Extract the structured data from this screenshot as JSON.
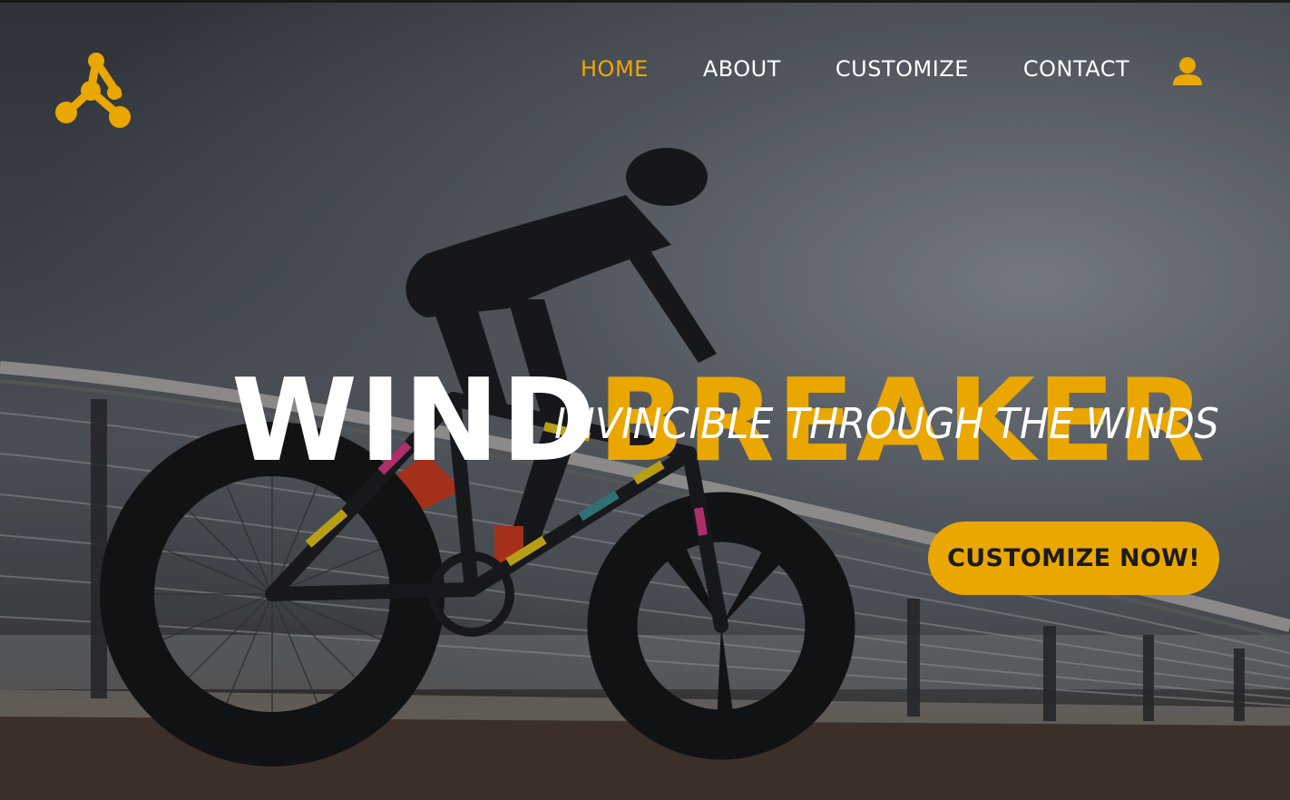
{
  "brand": {
    "logo_icon": "molecule-logo-icon",
    "accent_color": "#eaa700"
  },
  "nav": {
    "items": [
      {
        "label": "HOME",
        "active": true
      },
      {
        "label": "ABOUT",
        "active": false
      },
      {
        "label": "CUSTOMIZE",
        "active": false
      },
      {
        "label": "CONTACT",
        "active": false
      }
    ],
    "user_icon": "user-icon"
  },
  "hero": {
    "title_part1": "WIND",
    "title_part2": "BREAKER",
    "tagline": "INVINCIBLE THROUGH THE WINDS",
    "cta_label": "CUSTOMIZE NOW!",
    "background": "cyclist-on-bridge-photo"
  }
}
